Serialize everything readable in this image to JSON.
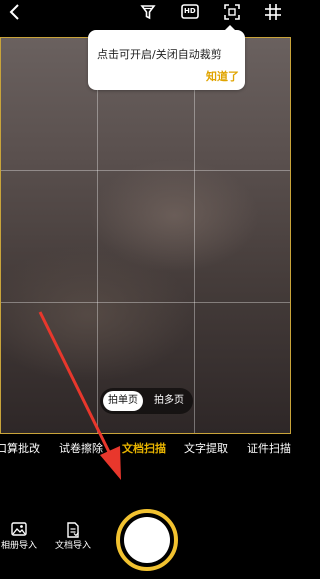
{
  "icons": {
    "back": "back-chevron-icon",
    "filter": "filter-icon",
    "hd": "HD",
    "auto_crop": "auto-crop-icon",
    "grid": "grid-icon"
  },
  "tooltip": {
    "text": "点击可开启/关闭自动裁剪",
    "confirm": "知道了"
  },
  "page_modes": {
    "single": "拍单页",
    "multi": "拍多页",
    "selected": "single"
  },
  "scan_modes": {
    "items": [
      "口算批改",
      "试卷擦除",
      "文档扫描",
      "文字提取",
      "证件扫描"
    ],
    "selected": "文档扫描"
  },
  "bottom_actions": {
    "album_import": "相册导入",
    "doc_import": "文档导入"
  },
  "colors": {
    "accent": "#e8b400",
    "frame": "#c9a43a",
    "annotation_arrow": "#e8372c"
  }
}
